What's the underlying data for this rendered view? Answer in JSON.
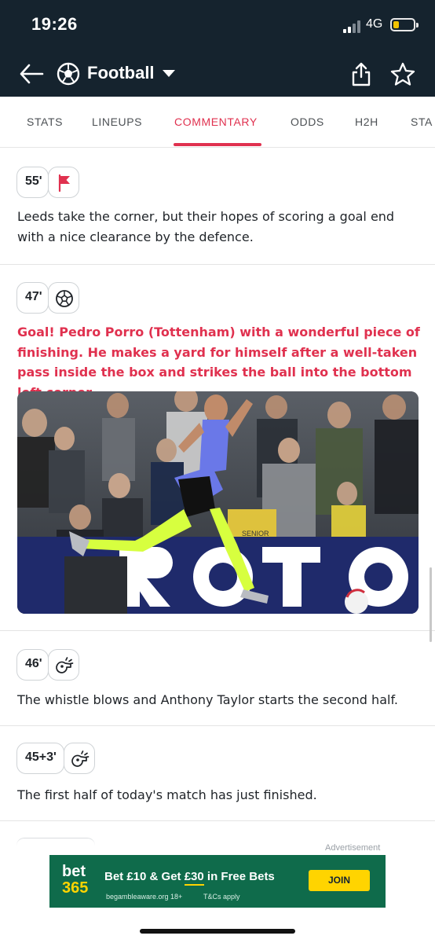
{
  "status_bar": {
    "time": "19:26",
    "network": "4G"
  },
  "header": {
    "title": "Football"
  },
  "tabs": [
    "STATS",
    "LINEUPS",
    "COMMENTARY",
    "ODDS",
    "H2H",
    "STA"
  ],
  "active_tab": "COMMENTARY",
  "commentary": [
    {
      "minute": "55'",
      "event_icon": "corner-flag-icon",
      "text": "Leeds take the corner, but their hopes of scoring a goal end with a nice clearance by the defence.",
      "highlight": false
    },
    {
      "minute": "47'",
      "event_icon": "football-icon",
      "text": "Goal! Pedro Porro (Tottenham) with a wonderful piece of finishing. He makes a yard for himself after a well-taken pass inside the box and strikes the ball into the bottom left corner.",
      "highlight": true,
      "photo_text": "SENIOR"
    },
    {
      "minute": "46'",
      "event_icon": "whistle-icon",
      "text": "The whistle blows and Anthony Taylor starts the second half.",
      "highlight": false
    },
    {
      "minute": "45+3'",
      "event_icon": "whistle-icon",
      "text": "The first half of today's match has just finished.",
      "highlight": false
    }
  ],
  "ad": {
    "label": "Advertisement",
    "logo_top": "bet",
    "logo_bottom": "365",
    "headline_a": "Bet £10 & Get ",
    "headline_b": "£30",
    "headline_c": " in Free Bets",
    "fine_print_1": "begambleaware.org  18+",
    "fine_print_2": "T&Cs apply",
    "cta": "JOIN"
  },
  "colors": {
    "header_bg": "#15232e",
    "accent": "#e0314f",
    "ad_bg": "#0f6b4b",
    "ad_yellow": "#ffd400"
  }
}
